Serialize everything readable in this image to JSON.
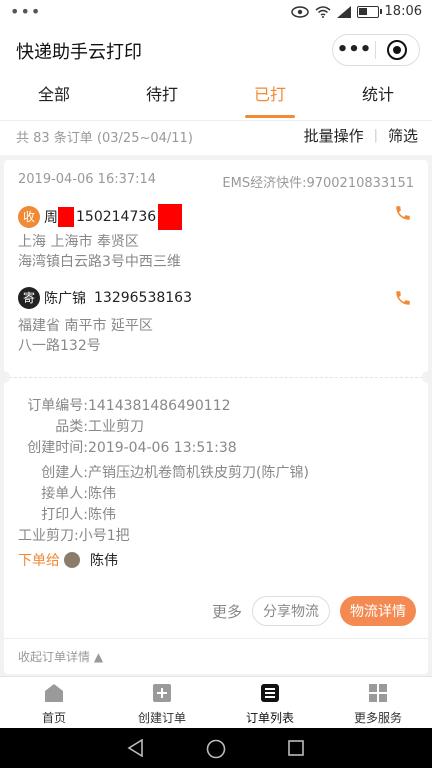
{
  "status_bar": {
    "dots": "•••",
    "time": "18:06",
    "battery_level": 0.45
  },
  "header": {
    "title": "快递助手云打印"
  },
  "tabs": [
    {
      "label": "全部",
      "active": false
    },
    {
      "label": "待打",
      "active": false
    },
    {
      "label": "已打",
      "active": true
    },
    {
      "label": "统计",
      "active": false
    }
  ],
  "subbar": {
    "count": "共 83 条订单 (03/25~04/11)",
    "batch": "批量操作",
    "divider": "|",
    "filter": "筛选"
  },
  "order": {
    "date": "2019-04-06 16:37:14",
    "express": "EMS经济快件:9700210833151",
    "sender": {
      "badge": "收",
      "name": "周",
      "phone": "150214736",
      "address_line1": "上海 上海市 奉贤区",
      "address_line2": "海湾镇白云路3号中西三维"
    },
    "receiver": {
      "badge": "寄",
      "name": "陈广锦",
      "phone": "13296538163",
      "address_line1": "福建省 南平市 延平区",
      "address_line2": "八一路132号"
    },
    "details": {
      "order_no_label": "订单编号:",
      "order_no": "1414381486490112",
      "category_label": "品类:",
      "category": "工业剪刀",
      "created_label": "创建时间:",
      "created": "2019-04-06 13:51:38",
      "creator_label": "创建人:",
      "creator": "产销压边机卷筒机铁皮剪刀(陈广锦)",
      "receiver_label": "接单人:",
      "receiver": "陈伟",
      "printer_label": "打印人:",
      "printer": "陈伟",
      "item": "工业剪刀:小号1把"
    },
    "assign": {
      "label": "下单给",
      "name": "陈伟"
    },
    "buttons": {
      "more": "更多",
      "share": "分享物流",
      "detail": "物流详情"
    },
    "collapse": "收起订单详情 ▲"
  },
  "tabbar": [
    {
      "label": "首页",
      "icon": "home-icon"
    },
    {
      "label": "创建订单",
      "icon": "add-icon"
    },
    {
      "label": "订单列表",
      "icon": "list-icon"
    },
    {
      "label": "更多服务",
      "icon": "grid-icon"
    }
  ],
  "colors": {
    "accent": "#f08a36",
    "button": "#f48a52",
    "redact": "#ff0000"
  }
}
